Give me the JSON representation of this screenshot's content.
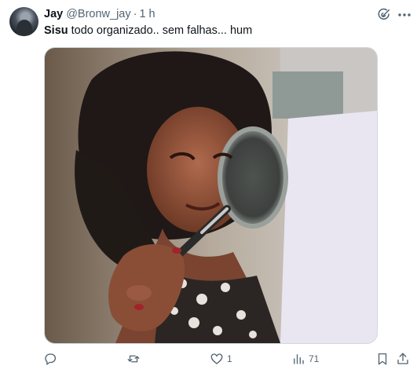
{
  "tweet": {
    "display_name": "Jay",
    "handle": "@Bronw_jay",
    "separator": "·",
    "time": "1 h",
    "text_bold": "Sisu",
    "text_rest": " todo organizado.. sem falhas... hum"
  },
  "media": {
    "description": "meme-photo-woman-with-magnifying-glass"
  },
  "actions": {
    "reply_count": "",
    "retweet_count": "",
    "like_count": "1",
    "views_count": "71"
  },
  "icons": {
    "grok": "grok-icon",
    "more": "more-icon",
    "reply": "reply-icon",
    "retweet": "retweet-icon",
    "like": "like-icon",
    "views": "views-icon",
    "bookmark": "bookmark-icon",
    "share": "share-icon"
  },
  "colors": {
    "text": "#0f1419",
    "secondary": "#536471",
    "border": "#cfd9de"
  }
}
